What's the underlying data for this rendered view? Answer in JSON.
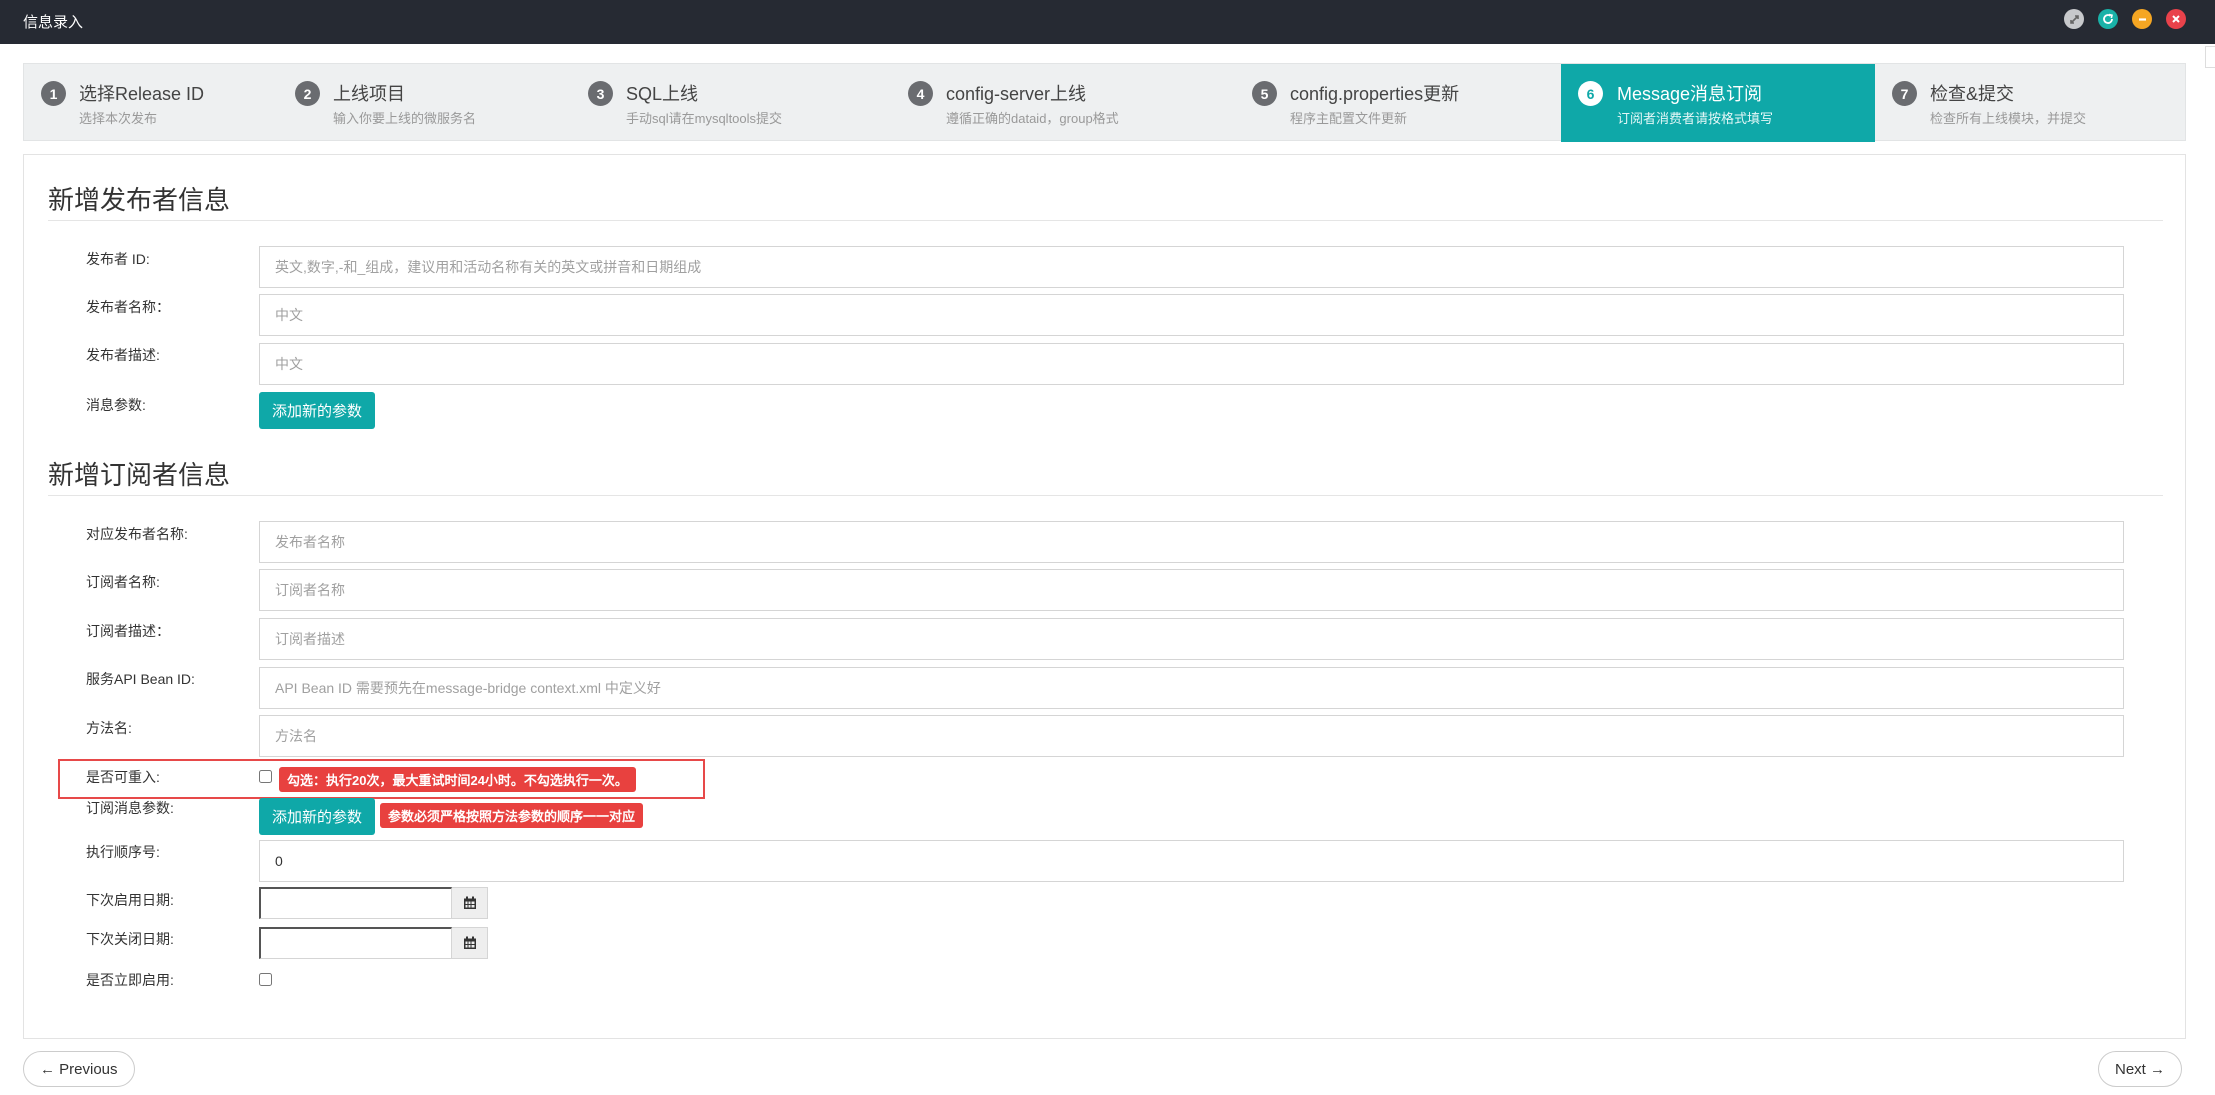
{
  "window": {
    "title": "信息录入",
    "controls": [
      "expand-icon",
      "refresh-icon",
      "minimize-icon",
      "close-icon"
    ],
    "colors": {
      "titlebar": "#262a33",
      "accent": "#0fa8a8",
      "danger": "#e8413f"
    }
  },
  "steps": [
    {
      "num": "1",
      "title": "选择Release ID",
      "sub": "选择本次发布"
    },
    {
      "num": "2",
      "title": "上线项目",
      "sub": "输入你要上线的微服务名"
    },
    {
      "num": "3",
      "title": "SQL上线",
      "sub": "手动sql请在mysqltools提交"
    },
    {
      "num": "4",
      "title": "config-server上线",
      "sub": "遵循正确的dataid，group格式"
    },
    {
      "num": "5",
      "title": "config.properties更新",
      "sub": "程序主配置文件更新"
    },
    {
      "num": "6",
      "title": "Message消息订阅",
      "sub": "订阅者消费者请按格式填写",
      "active": true
    },
    {
      "num": "7",
      "title": "检查&提交",
      "sub": "检查所有上线模块，并提交"
    }
  ],
  "publisher": {
    "heading": "新增发布者信息",
    "id_label": "发布者 ID:",
    "id_placeholder": "英文,数字,-和_组成，建议用和活动名称有关的英文或拼音和日期组成",
    "name_label": "发布者名称：",
    "name_placeholder": "中文",
    "desc_label": "发布者描述:",
    "desc_placeholder": "中文",
    "params_label": "消息参数:",
    "add_param_button": "添加新的参数"
  },
  "subscriber": {
    "heading": "新增订阅者信息",
    "pub_name_label": "对应发布者名称:",
    "pub_name_placeholder": "发布者名称",
    "name_label": "订阅者名称:",
    "name_placeholder": "订阅者名称",
    "desc_label": "订阅者描述：",
    "desc_placeholder": "订阅者描述",
    "bean_label": "服务API Bean ID:",
    "bean_placeholder": "API Bean ID 需要预先在message-bridge context.xml 中定义好",
    "method_label": "方法名:",
    "method_placeholder": "方法名",
    "reentrant_label": "是否可重入:",
    "reentrant_checked": false,
    "reentrant_tip": "勾选：执行20次，最大重试时间24小时。不勾选执行一次。",
    "params_label": "订阅消息参数:",
    "add_param_button": "添加新的参数",
    "params_tip": "参数必须严格按照方法参数的顺序一一对应",
    "order_label": "执行顺序号:",
    "order_value": "0",
    "next_start_label": "下次启用日期:",
    "next_start_value": "",
    "next_close_label": "下次关闭日期:",
    "next_close_value": "",
    "enable_now_label": "是否立即启用:",
    "enable_now_checked": false
  },
  "nav": {
    "previous": "← Previous",
    "next": "Next →"
  }
}
